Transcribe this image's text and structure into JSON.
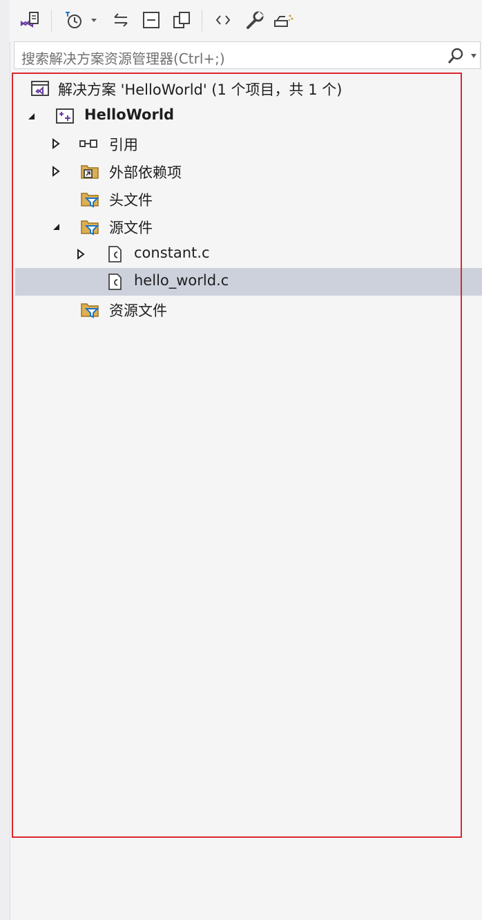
{
  "search": {
    "placeholder": "搜索解决方案资源管理器(Ctrl+;)"
  },
  "toolbar": {
    "buttons": [
      "vs-switch-views-icon",
      "history-icon",
      "dropdown-arrow-icon",
      "sync-icon",
      "collapse-all-icon",
      "show-all-files-icon",
      "code-view-icon",
      "properties-wrench-icon",
      "preview-icon"
    ]
  },
  "tree": {
    "solution": "解决方案 'HelloWorld' (1 个项目，共 1 个)",
    "project": "HelloWorld",
    "references": "引用",
    "external_deps": "外部依赖项",
    "header_files": "头文件",
    "source_files": "源文件",
    "file_constant": "constant.c",
    "file_hello": "hello_world.c",
    "resource_files": "资源文件"
  },
  "colors": {
    "selection": "#cdd1dc",
    "highlight_frame": "#d9262c",
    "vs_purple": "#6a3ea1",
    "folder": "#dcb052",
    "filter": "#1a73c8"
  }
}
